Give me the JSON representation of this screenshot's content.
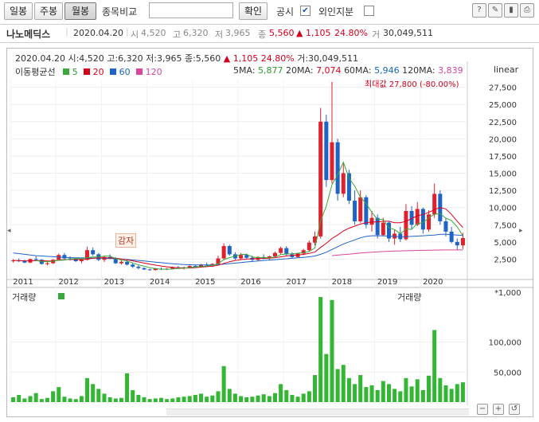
{
  "toolbar": {
    "period_buttons": [
      "일봉",
      "주봉",
      "월봉"
    ],
    "compare_label": "종목비교",
    "compare_placeholder": "",
    "confirm_label": "확인",
    "disclosure_label": "공시",
    "foreign_label": "외인지분"
  },
  "stock": {
    "name": "나노메딕스",
    "date": "2020.04.20",
    "open": "4,520",
    "high": "6,320",
    "low": "3,965",
    "close": "5,560",
    "change": "▲ 1,105",
    "change_pct": "24.80%",
    "volume": "30,049,511"
  },
  "chart_header": {
    "line1_date": "2020.04.20",
    "line1_open": "시:4,520",
    "line1_high": "고:6,320",
    "line1_low": "저:3,965",
    "line1_close": "종:5,560",
    "line1_change": "1,105",
    "line1_pct": "24.80%",
    "line1_vol": "거:30,049,511",
    "ma_title": "이동평균선",
    "ma_legend": [
      {
        "label": "5",
        "color": "#3aa83a"
      },
      {
        "label": "20",
        "color": "#d4001c"
      },
      {
        "label": "60",
        "color": "#1f63c7"
      },
      {
        "label": "120",
        "color": "#d9469b"
      }
    ],
    "ma5_label": "5MA:",
    "ma5": "5,877",
    "ma20_label": "20MA:",
    "ma20": "7,074",
    "ma60_label": "60MA:",
    "ma60": "5,946",
    "ma120_label": "120MA:",
    "ma120": "3,839",
    "scale": "linear",
    "max_label": "최대값 27,800 (-80.00%)",
    "min_label": "감자",
    "volume_label": "거래량",
    "volume_label2": "거래량",
    "volume_unit": "*1,000"
  },
  "chart_data": {
    "type": "candlestick",
    "x_ticks": [
      "2011",
      "2012",
      "2013",
      "2014",
      "2015",
      "2016",
      "2017",
      "2018",
      "2019",
      "2020"
    ],
    "price_ticks": [
      "27,500",
      "25,000",
      "22,500",
      "20,000",
      "17,500",
      "15,000",
      "12,500",
      "10,000",
      "7,500",
      "5,000",
      "2,500"
    ],
    "price_ylim": [
      0,
      28500
    ],
    "volume_ticks": [
      "100,000",
      "50,000"
    ],
    "volume_ylim": [
      0,
      175000
    ],
    "candles": [
      [
        2200,
        2500,
        2000,
        2300
      ],
      [
        2300,
        2600,
        2100,
        2200
      ],
      [
        2200,
        2400,
        1900,
        2000
      ],
      [
        2000,
        2600,
        1900,
        2500
      ],
      [
        2500,
        2900,
        2300,
        2400
      ],
      [
        2400,
        2500,
        1700,
        1800
      ],
      [
        1800,
        2100,
        1600,
        1900
      ],
      [
        1900,
        2500,
        1800,
        2400
      ],
      [
        2400,
        3300,
        2300,
        3100
      ],
      [
        3100,
        3400,
        2500,
        2600
      ],
      [
        2600,
        2900,
        2300,
        2500
      ],
      [
        2500,
        2700,
        2100,
        2200
      ],
      [
        2200,
        2600,
        1900,
        2400
      ],
      [
        2400,
        4300,
        2300,
        3800
      ],
      [
        3800,
        4200,
        3000,
        3200
      ],
      [
        3200,
        3400,
        2200,
        2400
      ],
      [
        2400,
        3000,
        2100,
        2800
      ],
      [
        2800,
        3200,
        2500,
        2600
      ],
      [
        2600,
        2800,
        1800,
        1900
      ],
      [
        1900,
        2300,
        1700,
        2100
      ],
      [
        2100,
        2400,
        1600,
        1700
      ],
      [
        1700,
        2000,
        1200,
        1400
      ],
      [
        1400,
        1600,
        1000,
        1200
      ],
      [
        1200,
        1300,
        900,
        1000
      ],
      [
        1000,
        1100,
        800,
        900
      ],
      [
        900,
        1200,
        850,
        1100
      ],
      [
        1100,
        1300,
        900,
        1000
      ],
      [
        1000,
        1200,
        900,
        1100
      ],
      [
        1100,
        1400,
        1000,
        1300
      ],
      [
        1300,
        1500,
        1100,
        1200
      ],
      [
        1200,
        1400,
        1000,
        1300
      ],
      [
        1300,
        1600,
        1200,
        1500
      ],
      [
        1500,
        1700,
        1300,
        1400
      ],
      [
        1400,
        1800,
        1300,
        1700
      ],
      [
        1700,
        2000,
        1500,
        1600
      ],
      [
        1600,
        1900,
        1400,
        1800
      ],
      [
        1800,
        3000,
        1700,
        2600
      ],
      [
        2600,
        4800,
        2500,
        4400
      ],
      [
        4400,
        4600,
        3000,
        3200
      ],
      [
        3200,
        3500,
        2400,
        2600
      ],
      [
        2600,
        3400,
        2400,
        3100
      ],
      [
        3100,
        3300,
        2500,
        2700
      ],
      [
        2700,
        3000,
        2200,
        2400
      ],
      [
        2400,
        2900,
        2200,
        2800
      ],
      [
        2800,
        3200,
        2500,
        2600
      ],
      [
        2600,
        3000,
        2300,
        2900
      ],
      [
        2900,
        3600,
        2800,
        3400
      ],
      [
        3400,
        4300,
        3200,
        4100
      ],
      [
        4100,
        4400,
        3000,
        3200
      ],
      [
        3200,
        3500,
        2600,
        2800
      ],
      [
        2800,
        3400,
        2700,
        3300
      ],
      [
        3300,
        4000,
        3100,
        3800
      ],
      [
        3800,
        5200,
        3600,
        4900
      ],
      [
        4900,
        6500,
        4500,
        5800
      ],
      [
        5800,
        24500,
        5500,
        22500
      ],
      [
        22500,
        23500,
        13000,
        14000
      ],
      [
        14000,
        27800,
        13500,
        19500
      ],
      [
        19500,
        20000,
        11000,
        12000
      ],
      [
        12000,
        16500,
        11500,
        15000
      ],
      [
        15000,
        15500,
        10500,
        11000
      ],
      [
        11000,
        12500,
        7500,
        8000
      ],
      [
        8000,
        12500,
        7800,
        11500
      ],
      [
        11500,
        11800,
        7000,
        7500
      ],
      [
        7500,
        9500,
        6500,
        8500
      ],
      [
        8500,
        9000,
        5500,
        6000
      ],
      [
        6000,
        8500,
        5800,
        7800
      ],
      [
        7800,
        8000,
        5000,
        5500
      ],
      [
        5500,
        6800,
        4600,
        6200
      ],
      [
        6200,
        7200,
        5000,
        5400
      ],
      [
        5400,
        10500,
        5200,
        9500
      ],
      [
        9500,
        10200,
        6800,
        7500
      ],
      [
        7500,
        10800,
        7300,
        9800
      ],
      [
        9800,
        10000,
        6200,
        6800
      ],
      [
        6800,
        9600,
        6500,
        9000
      ],
      [
        9000,
        13500,
        8500,
        12000
      ],
      [
        12000,
        12500,
        7500,
        8000
      ],
      [
        8000,
        8500,
        5800,
        6500
      ],
      [
        6500,
        7200,
        4800,
        5000
      ],
      [
        5000,
        5500,
        3800,
        4500
      ],
      [
        4500,
        6320,
        3965,
        5560
      ]
    ],
    "ma20": [
      2300,
      2280,
      2250,
      2250,
      2280,
      2270,
      2240,
      2250,
      2350,
      2420,
      2450,
      2450,
      2430,
      2500,
      2620,
      2680,
      2680,
      2670,
      2620,
      2520,
      2400,
      2250,
      2080,
      1920,
      1760,
      1620,
      1500,
      1380,
      1300,
      1240,
      1200,
      1210,
      1260,
      1330,
      1400,
      1460,
      1600,
      1880,
      2120,
      2300,
      2420,
      2500,
      2550,
      2580,
      2600,
      2640,
      2710,
      2830,
      2960,
      3040,
      3120,
      3190,
      3320,
      3520,
      4200,
      4800,
      5500,
      6000,
      6600,
      7000,
      7300,
      7600,
      7800,
      7900,
      7900,
      8000,
      8000,
      7800,
      7800,
      8000,
      8400,
      8800,
      9000,
      9300,
      9700,
      10000,
      9800,
      9000,
      8000,
      7100
    ],
    "ma60": [
      3400,
      3300,
      3200,
      3100,
      3000,
      2950,
      2900,
      2850,
      2800,
      2760,
      2720,
      2700,
      2680,
      2660,
      2650,
      2640,
      2620,
      2600,
      2560,
      2500,
      2440,
      2380,
      2300,
      2220,
      2140,
      2060,
      1980,
      1900,
      1830,
      1770,
      1720,
      1680,
      1650,
      1640,
      1640,
      1660,
      1700,
      1760,
      1840,
      1920,
      2000,
      2080,
      2160,
      2230,
      2300,
      2360,
      2420,
      2480,
      2550,
      2620,
      2690,
      2760,
      2840,
      2960,
      3200,
      3500,
      3900,
      4300,
      4700,
      5000,
      5300,
      5600,
      5800,
      5900,
      5900,
      5900,
      5850,
      5800,
      5750,
      5750,
      5800,
      5850,
      5900,
      5950,
      6000,
      6100,
      6100,
      6050,
      6000,
      5946
    ],
    "ma120": [
      null,
      null,
      null,
      null,
      null,
      null,
      null,
      null,
      null,
      null,
      null,
      null,
      null,
      null,
      null,
      null,
      null,
      null,
      null,
      null,
      null,
      null,
      null,
      null,
      null,
      null,
      null,
      null,
      null,
      null,
      null,
      null,
      null,
      null,
      null,
      null,
      null,
      null,
      null,
      null,
      null,
      null,
      null,
      null,
      null,
      null,
      null,
      null,
      null,
      null,
      null,
      null,
      null,
      null,
      null,
      null,
      3000,
      3080,
      3150,
      3220,
      3300,
      3380,
      3450,
      3500,
      3550,
      3600,
      3640,
      3680,
      3700,
      3720,
      3740,
      3760,
      3780,
      3800,
      3810,
      3820,
      3830,
      3835,
      3838,
      3839
    ],
    "volumes": [
      8,
      12,
      6,
      10,
      15,
      5,
      7,
      18,
      25,
      9,
      6,
      5,
      10,
      40,
      30,
      22,
      14,
      8,
      6,
      7,
      48,
      20,
      12,
      8,
      5,
      6,
      7,
      5,
      6,
      8,
      9,
      10,
      12,
      14,
      9,
      11,
      18,
      60,
      22,
      14,
      10,
      8,
      9,
      11,
      13,
      10,
      15,
      30,
      20,
      12,
      9,
      14,
      18,
      45,
      175,
      80,
      170,
      55,
      62,
      40,
      30,
      45,
      25,
      28,
      20,
      35,
      30,
      22,
      18,
      40,
      26,
      38,
      20,
      44,
      120,
      40,
      28,
      22,
      30,
      33
    ]
  }
}
